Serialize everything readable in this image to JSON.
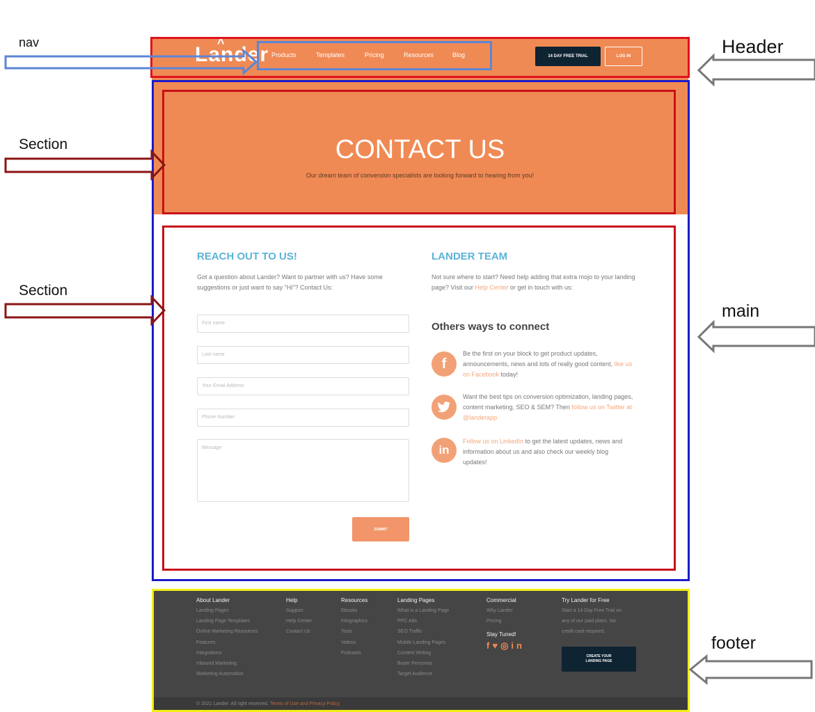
{
  "annotations": {
    "nav": "nav",
    "header": "Header",
    "section_1": "Section",
    "section_2": "Section",
    "main": "main",
    "footer": "footer"
  },
  "header": {
    "logo": "Lander",
    "nav": [
      "Products",
      "Templates",
      "Pricing",
      "Resources",
      "Blog"
    ],
    "trial_button": "14 DAY FREE TRIAL",
    "login_button": "LOG IN"
  },
  "hero": {
    "title": "CONTACT US",
    "subtitle": "Our dream team of conversion specialists are looking forward to hearing from you!"
  },
  "contact": {
    "left_title": "REACH OUT TO US!",
    "left_intro": "Got a question about Lander? Want to partner with us? Have some suggestions or just want to say \"Hi\"? Contact Us:",
    "fields": {
      "first_name": "First name",
      "last_name": "Last name",
      "email": "Your Email Address",
      "phone": "Phone Number",
      "message": "Message"
    },
    "submit": "SUBMIT",
    "right_title": "LANDER TEAM",
    "right_intro_pre": "Not sure where to start? Need help adding that extra mojo to your landing page? Visit our ",
    "right_intro_link": "Help Center",
    "right_intro_post": " or get in touch with us:",
    "connect_title": "Others ways to connect",
    "social": [
      {
        "icon": "facebook-icon",
        "text": "Be the first on your block to get product updates, announcements, news and lots of really good content, ",
        "link": "like us on Facebook",
        "after": " today!"
      },
      {
        "icon": "twitter-icon",
        "text": "Want the best tips on conversion optimization, landing pages, content marketing, SEO & SEM? Then ",
        "link": "follow us on Twitter at @landerapp",
        "after": ""
      },
      {
        "icon": "linkedin-icon",
        "text": "",
        "link": "Follow us on LinkedIn",
        "after": " to get the latest updates, news and information about us and also check our weekly blog updates!"
      }
    ]
  },
  "footer": {
    "columns": [
      {
        "title": "About Lander",
        "items": [
          "Landing Pages",
          "Landing Page Templates",
          "Online Marketing Resources",
          "Features",
          "Integrations",
          "Inbound Marketing",
          "Marketing Automation"
        ]
      },
      {
        "title": "Help",
        "items": [
          "Support",
          "Help Center",
          "Contact Us"
        ]
      },
      {
        "title": "Resources",
        "items": [
          "Ebooks",
          "Infographics",
          "Tools",
          "Videos",
          "Podcasts"
        ]
      },
      {
        "title": "Landing Pages",
        "items": [
          "What is a Landing Page",
          "PPC Ads",
          "SEO Traffic",
          "Mobile Landing Pages",
          "Content Writing",
          "Buyer Personas",
          "Target Audience"
        ]
      },
      {
        "title": "Commercial",
        "items": [
          "Why Lander",
          "Pricing"
        ]
      },
      {
        "title": "Try Lander for Free",
        "items": [
          "Start a 14 Day Free Trial on",
          "any of our paid plans. No",
          "credit card required."
        ]
      }
    ],
    "stay_tuned": "Stay Tuned!",
    "cta_line1": "CREATE YOUR",
    "cta_line2": "LANDING PAGE",
    "copyright": "© 2021 Lander. All right reserved. ",
    "terms": "Terms of Use and Privacy Policy"
  },
  "colors": {
    "brand_orange": "#f08a54",
    "heading_blue": "#5bb3d6",
    "dark_navy": "#0f2433",
    "footer_gray": "#454545"
  }
}
